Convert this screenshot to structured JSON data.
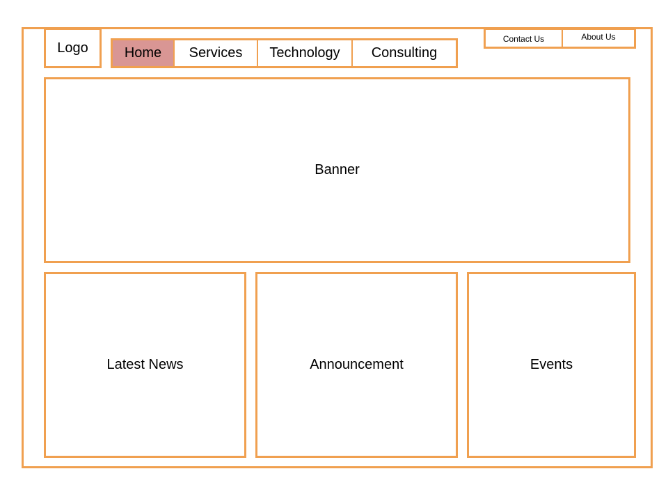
{
  "logo": {
    "label": "Logo"
  },
  "nav": {
    "items": [
      {
        "label": "Home",
        "active": true
      },
      {
        "label": "Services",
        "active": false
      },
      {
        "label": "Technology",
        "active": false
      },
      {
        "label": "Consulting",
        "active": false
      }
    ]
  },
  "utility_links": {
    "contact": "Contact Us",
    "about": "About Us"
  },
  "banner": {
    "label": "Banner"
  },
  "panels": {
    "news": "Latest News",
    "announcement": "Announcement",
    "events": "Events"
  },
  "colors": {
    "border": "#f0a050",
    "active_tab": "#d99694",
    "background": "#ffffff"
  }
}
